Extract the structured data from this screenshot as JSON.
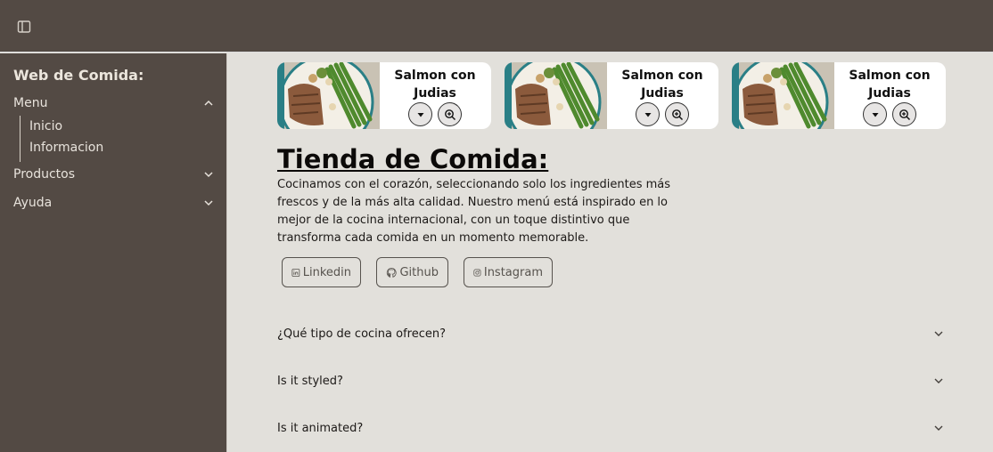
{
  "sidebar": {
    "title": "Web de Comida:",
    "menu_label": "Menu",
    "sub_items": [
      "Inicio",
      "Informacion"
    ],
    "productos_label": "Productos",
    "ayuda_label": "Ayuda"
  },
  "cards": [
    {
      "title": "Salmon con Judias"
    },
    {
      "title": "Salmon con Judias"
    },
    {
      "title": "Salmon con Judias"
    }
  ],
  "hero": {
    "title": "Tienda de Comida:",
    "description": "Cocinamos con el corazón, seleccionando solo los ingredientes más frescos y de la más alta calidad. Nuestro menú está inspirado en lo mejor de la cocina internacional, con un toque distintivo que transforma cada comida en un momento memorable."
  },
  "social": {
    "linkedin": "Linkedin",
    "github": "Github",
    "instagram": "Instagram"
  },
  "faq": [
    {
      "question": "¿Qué tipo de cocina ofrecen?"
    },
    {
      "question": "Is it styled?"
    },
    {
      "question": "Is it animated?"
    }
  ],
  "colors": {
    "header_bg": "#534a44",
    "sidebar_bg": "#534a44",
    "main_bg": "#e2e0db",
    "card_bg": "#ffffff"
  }
}
